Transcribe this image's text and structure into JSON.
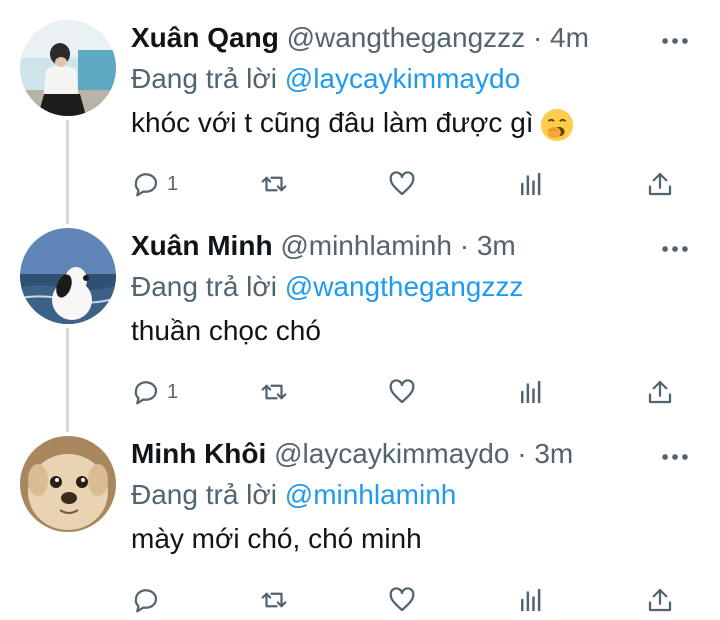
{
  "reply_prefix": "Đang trả lời",
  "tweets": [
    {
      "display_name": "Xuân Qang",
      "handle": "@wangthegangzzz",
      "separator": "·",
      "time": "4m",
      "reply_to": "@laycaykimmaydo",
      "text": "khóc với t cũng đâu làm được gì",
      "emoji": "yawning-face",
      "reply_count": "1"
    },
    {
      "display_name": "Xuân Minh",
      "handle": "@minhlaminh",
      "separator": "·",
      "time": "3m",
      "reply_to": "@wangthegangzzz",
      "text": "thuần chọc chó",
      "reply_count": "1"
    },
    {
      "display_name": "Minh Khôi",
      "handle": "@laycaykimmaydo",
      "separator": "·",
      "time": "3m",
      "reply_to": "@minhlaminh",
      "text": "mày mới chó, chó minh",
      "reply_count": ""
    }
  ],
  "colors": {
    "accent": "#1d9bf0",
    "secondary_text": "#536471",
    "thread_line": "#cfd9de"
  },
  "icons": [
    "more-icon",
    "reply-icon",
    "retweet-icon",
    "like-icon",
    "analytics-icon",
    "share-icon"
  ]
}
